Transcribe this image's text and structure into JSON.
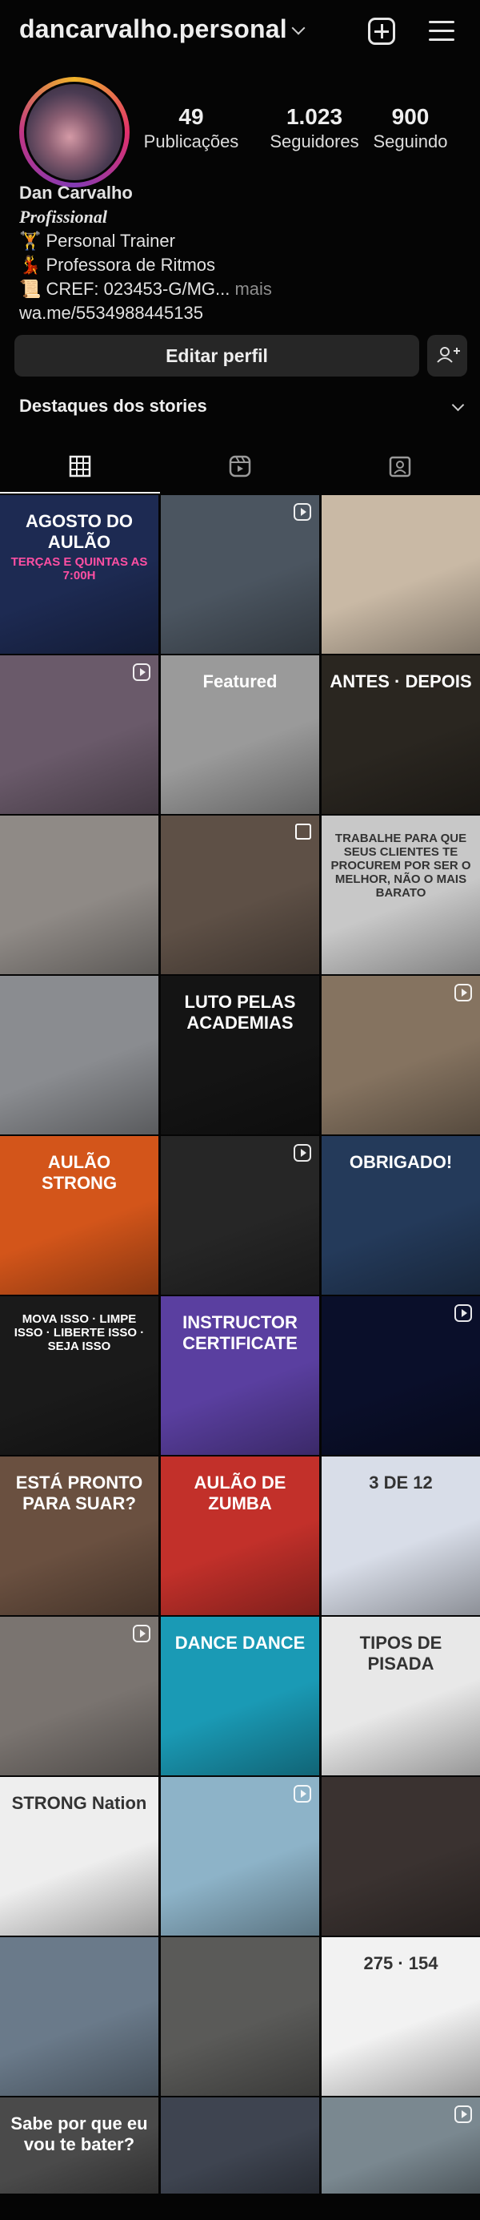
{
  "profile": {
    "username": "dancarvalho.personal",
    "stats": [
      {
        "value": "49",
        "label": "Publicações"
      },
      {
        "value": "1.023",
        "label": "Seguidores"
      },
      {
        "value": "900",
        "label": "Seguindo"
      }
    ],
    "name": "Dan Carvalho",
    "category": "Profissional",
    "bio_lines": [
      "🏋 Personal Trainer",
      "💃 Professora de Ritmos",
      "📜 CREF: 023453-G/MG..."
    ],
    "more_label": "mais",
    "link": "wa.me/5534988445135",
    "edit_button": "Editar perfil",
    "highlights_label": "Destaques dos stories"
  },
  "tiles": [
    {
      "title": "AGOSTO DO AULÃO",
      "subtitle": "TERÇAS E QUINTAS AS 7:00H",
      "bg": "#1d2a52"
    },
    {
      "title": "",
      "bg": "#4b5560",
      "reel": true
    },
    {
      "title": "",
      "bg": "#c9b9a5"
    },
    {
      "title": "",
      "bg": "#6a5a6a",
      "reel": true
    },
    {
      "title": "Featured",
      "bg": "#9a9a9a"
    },
    {
      "title": "ANTES · DEPOIS",
      "bg": "#2a2620"
    },
    {
      "title": "",
      "bg": "#8f8a86"
    },
    {
      "title": "",
      "bg": "#5e5046",
      "multi": true
    },
    {
      "title": "TRABALHE PARA QUE SEUS CLIENTES TE PROCUREM POR SER O MELHOR, NÃO O MAIS BARATO",
      "bg": "#c8c8c8"
    },
    {
      "title": "",
      "bg": "#8a8c90"
    },
    {
      "title": "LUTO PELAS ACADEMIAS",
      "bg": "#141414"
    },
    {
      "title": "",
      "bg": "#857360",
      "reel": true
    },
    {
      "title": "AULÃO STRONG",
      "bg": "#d3551a"
    },
    {
      "title": "",
      "bg": "#262626",
      "reel": true
    },
    {
      "title": "OBRIGADO!",
      "bg": "#243a5a"
    },
    {
      "title": "MOVA ISSO · LIMPE ISSO · LIBERTE ISSO · SEJA ISSO",
      "bg": "#1a1a1a"
    },
    {
      "title": "INSTRUCTOR CERTIFICATE",
      "bg": "#5a3fa0"
    },
    {
      "title": "",
      "bg": "#0a0f2a",
      "reel": true
    },
    {
      "title": "ESTÁ PRONTO PARA SUAR?",
      "bg": "#6a5040"
    },
    {
      "title": "AULÃO DE ZUMBA",
      "bg": "#c2302a"
    },
    {
      "title": "3 DE 12",
      "bg": "#d8dde8"
    },
    {
      "title": "",
      "bg": "#7a7470",
      "reel": true
    },
    {
      "title": "DANCE DANCE",
      "bg": "#1a9ab5"
    },
    {
      "title": "TIPOS DE PISADA",
      "bg": "#e8e8e8"
    },
    {
      "title": "STRONG Nation",
      "bg": "#eeeeee"
    },
    {
      "title": "",
      "bg": "#8db3c8",
      "reel": true
    },
    {
      "title": "",
      "bg": "#3a3230"
    },
    {
      "title": "",
      "bg": "#6a7a8a"
    },
    {
      "title": "",
      "bg": "#5a5a58"
    },
    {
      "title": "275 · 154",
      "bg": "#f2f2f2"
    },
    {
      "title": "Sabe por que eu vou te bater?",
      "bg": "#4a4a4a"
    },
    {
      "title": "",
      "bg": "#3e4450"
    },
    {
      "title": "",
      "bg": "#7a8890",
      "reel": true
    }
  ]
}
